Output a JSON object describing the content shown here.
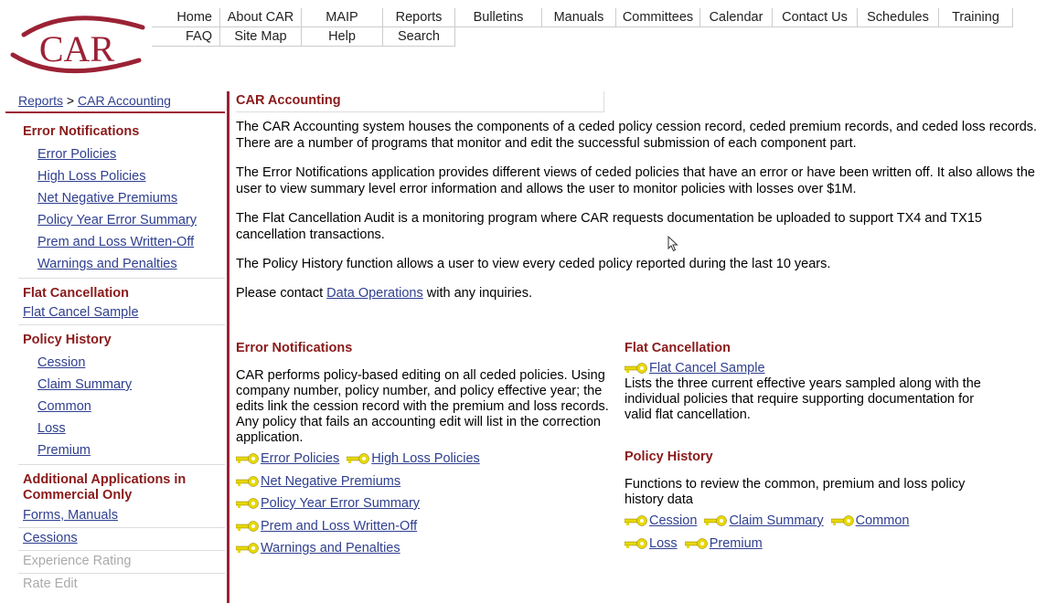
{
  "logo": {
    "text": "CAR"
  },
  "nav": {
    "row1": [
      "Home",
      "About CAR",
      "MAIP",
      "Reports",
      "Bulletins",
      "Manuals",
      "Committees",
      "Calendar",
      "Contact Us",
      "Schedules",
      "Training"
    ],
    "row2": [
      "FAQ",
      "Site Map",
      "Help",
      "Search"
    ]
  },
  "breadcrumb": {
    "reports": "Reports",
    "sep": ">",
    "current": "CAR Accounting"
  },
  "sidebar": {
    "error_title": "Error Notifications",
    "error_items": [
      "Error Policies",
      "High Loss Policies",
      "Net Negative Premiums",
      "Policy Year Error Summary",
      "Prem and Loss Written-Off",
      "Warnings and Penalties"
    ],
    "flat_title": "Flat Cancellation",
    "flat_item": "Flat Cancel Sample",
    "policy_title": "Policy History",
    "policy_items": [
      "Cession",
      "Claim Summary",
      "Common",
      "Loss",
      "Premium"
    ],
    "additional_title": "Additional Applications in Commercial Only",
    "additional_items": [
      "Forms, Manuals",
      "Cessions",
      "Experience Rating",
      "Rate Edit"
    ]
  },
  "main": {
    "title": "CAR Accounting",
    "p1": "The CAR Accounting system houses the components of a ceded policy cession record, ceded premium records, and ceded loss records. There are a number of programs that monitor and edit the successful submission of each component part.",
    "p2": "The Error Notifications application provides different views of ceded policies that have an error or have been written off. It also allows the user to view summary level error information and allows the user to monitor policies with losses over $1M.",
    "p3": "The Flat Cancellation Audit is a monitoring program where CAR requests documentation be uploaded to support TX4 and TX15 cancellation transactions.",
    "p4": "The Policy History function allows a user to view every ceded policy reported during the last 10 years.",
    "p5_pre": "Please contact ",
    "p5_link": "Data Operations",
    "p5_post": " with any inquiries.",
    "error_title": "Error Notifications",
    "error_desc": "CAR performs policy-based editing on all ceded policies. Using company number, policy number, and policy effective year; the edits link the cession record with the premium and loss records. Any policy that fails an accounting edit will list in the correction application.",
    "error_links": [
      "Error Policies",
      "High Loss Policies",
      "Net Negative Premiums",
      "Policy Year Error Summary",
      "Prem and Loss Written-Off",
      "Warnings and Penalties"
    ],
    "flat_title": "Flat Cancellation",
    "flat_link": "Flat Cancel Sample",
    "flat_desc": "Lists the three current effective years sampled along with the individual policies that require supporting documentation for valid flat cancellation.",
    "policy_title": "Policy History",
    "policy_desc": "Functions to review the common, premium and loss policy history data",
    "policy_links": [
      "Cession",
      "Claim Summary",
      "Common",
      "Loss",
      "Premium"
    ]
  },
  "colors": {
    "accent": "#8b1a1a",
    "link": "#2f3f8f",
    "key_yellow": "#e8d800"
  }
}
